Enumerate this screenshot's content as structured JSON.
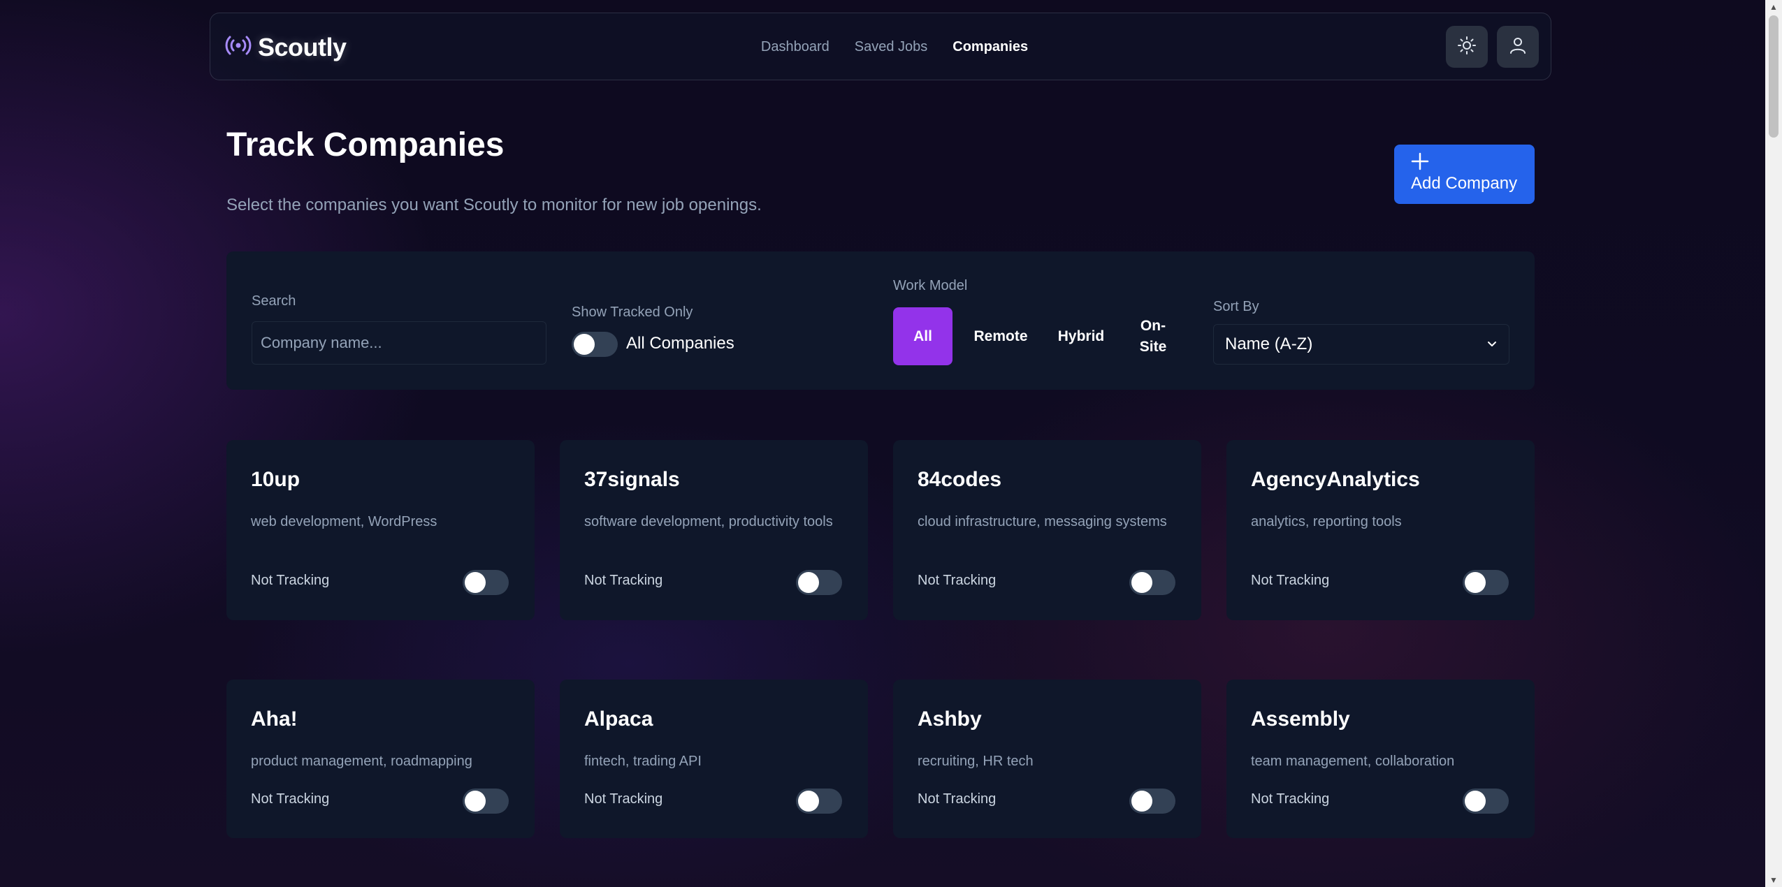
{
  "nav": {
    "brand": "Scoutly",
    "links": [
      "Dashboard",
      "Saved Jobs",
      "Companies"
    ],
    "active_link": "Companies"
  },
  "header": {
    "title": "Track Companies",
    "subtitle": "Select the companies you want Scoutly to monitor for new job openings.",
    "add_button_icon": "plus-icon",
    "add_button_label": "Add Company"
  },
  "filters": {
    "search_label": "Search",
    "search_placeholder": "Company name...",
    "search_value": "",
    "tracked_label": "Show Tracked Only",
    "tracked_toggle_text": "All Companies",
    "tracked_toggle_on": false,
    "work_model_label": "Work Model",
    "work_model_options": [
      "All",
      "Remote",
      "Hybrid",
      "On-Site"
    ],
    "work_model_selected": "All",
    "sort_label": "Sort By",
    "sort_value": "Name (A-Z)"
  },
  "companies": [
    {
      "name": "10up",
      "tags": "web development, WordPress",
      "status": "Not Tracking",
      "tracking": false
    },
    {
      "name": "37signals",
      "tags": "software development, productivity tools",
      "status": "Not Tracking",
      "tracking": false
    },
    {
      "name": "84codes",
      "tags": "cloud infrastructure, messaging systems",
      "status": "Not Tracking",
      "tracking": false
    },
    {
      "name": "AgencyAnalytics",
      "tags": "analytics, reporting tools",
      "status": "Not Tracking",
      "tracking": false
    },
    {
      "name": "Aha!",
      "tags": "product management, roadmapping",
      "status": "Not Tracking",
      "tracking": false
    },
    {
      "name": "Alpaca",
      "tags": "fintech, trading API",
      "status": "Not Tracking",
      "tracking": false
    },
    {
      "name": "Ashby",
      "tags": "recruiting, HR tech",
      "status": "Not Tracking",
      "tracking": false
    },
    {
      "name": "Assembly",
      "tags": "team management, collaboration",
      "status": "Not Tracking",
      "tracking": false
    }
  ],
  "colors": {
    "accent_purple": "#9333ea",
    "primary_blue": "#2563eb",
    "card_bg": "#0f172a",
    "brand_icon": "#a78bfa"
  },
  "icons": {
    "brand": "broadcast-icon",
    "theme": "sun-icon",
    "account": "user-icon",
    "sort": "chevron-down-icon"
  }
}
